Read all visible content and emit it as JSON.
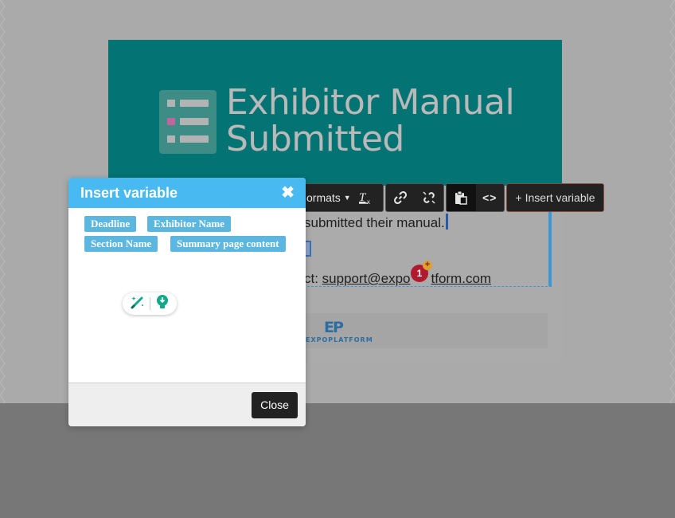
{
  "hero": {
    "title_line1": "Exhibitor Manual",
    "title_line2": "Submitted",
    "icon": "checklist-icon"
  },
  "editor": {
    "line1": "submitted their manual.",
    "line3_prefix": "ct: ",
    "line3_link": "support@expoplatform.com",
    "line3_link_visible_start": "support@expo",
    "line3_link_visible_end": "tform.com",
    "variable_brace": "}"
  },
  "footer": {
    "logo_mark": "EP",
    "logo_word": "EXPOPLATFORM"
  },
  "toolbar": {
    "formats_label": "ormats",
    "clear_format_icon": "clear-formatting-icon",
    "link_icon": "link-icon",
    "unlink_icon": "unlink-icon",
    "paste_icon": "paste-icon",
    "code_icon": "code-icon",
    "insert_variable_label": "+ Insert variable"
  },
  "notification": {
    "count": "1",
    "plus": "+"
  },
  "modal": {
    "title": "Insert variable",
    "close_symbol": "✖",
    "variables": [
      "Deadline",
      "Exhibitor Name",
      "Section Name",
      "Summary page content"
    ],
    "helper_icons": [
      "magic-pen-icon",
      "lightbulb-icon"
    ],
    "close_label": "Close"
  },
  "colors": {
    "hero_bg": "#037373",
    "modal_header": "#49b9f1",
    "variable_tag": "#5bb7e0",
    "toolbar_bg": "#222222",
    "badge": "#b0192e"
  }
}
